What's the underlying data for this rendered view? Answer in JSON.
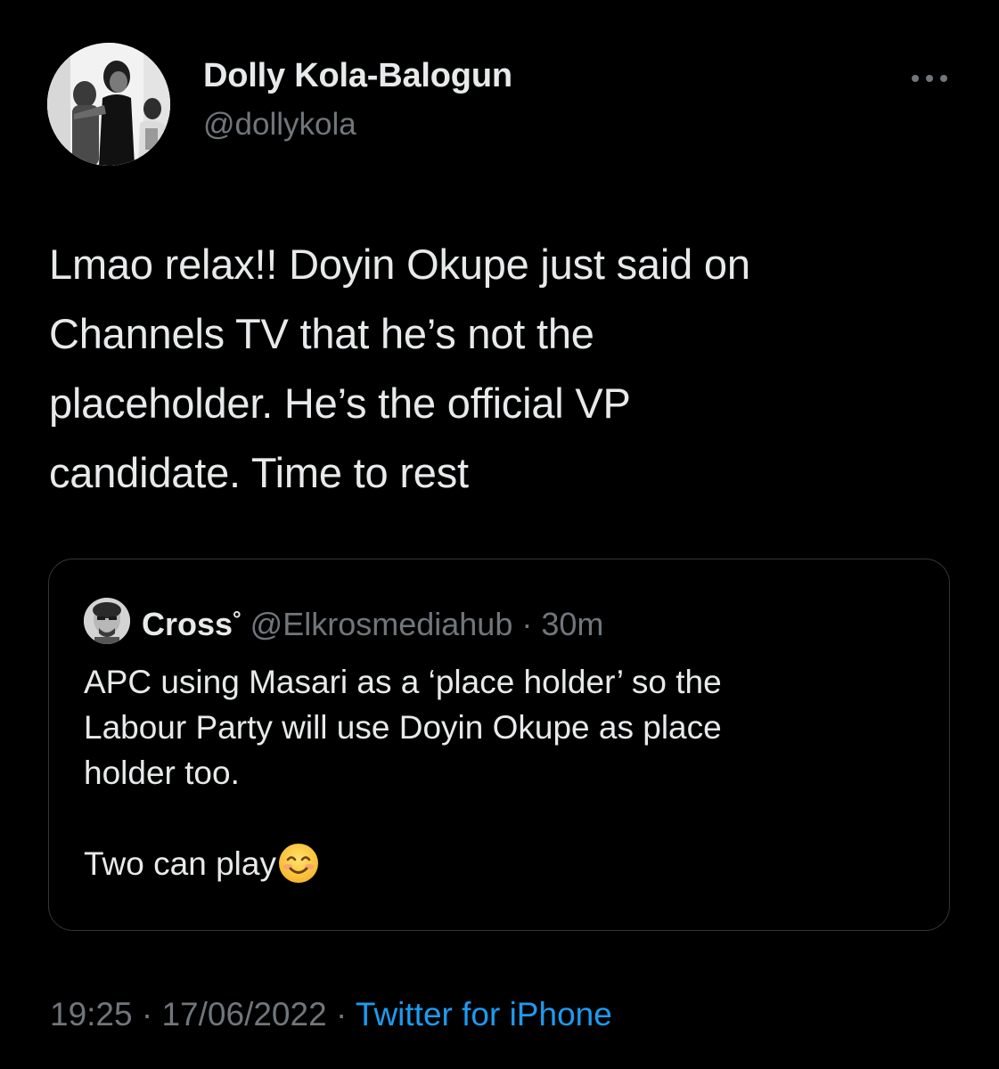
{
  "author": {
    "display_name": "Dolly Kola-Balogun",
    "handle": "@dollykola",
    "avatar_icon": "profile-photo"
  },
  "more_icon": "more-horizontal-icon",
  "tweet": {
    "lines": [
      "Lmao relax!! Doyin Okupe just said on",
      "Channels TV that he’s not the",
      "placeholder. He’s the official VP",
      "candidate. Time to rest"
    ]
  },
  "quote": {
    "avatar_icon": "quoted-user-avatar",
    "display_name": "Cross",
    "name_suffix": "°",
    "handle": "@Elkrosmediahub",
    "separator": " · ",
    "time": "30m",
    "lines": [
      "APC using Masari as a ‘place holder’ so the",
      "Labour Party will use Doyin Okupe as place",
      "holder too.",
      "",
      "Two can play"
    ],
    "emoji_icon": "smiling-face-emoji"
  },
  "footer": {
    "time": "19:25",
    "separator": " · ",
    "date": "17/06/2022",
    "source": "Twitter for iPhone"
  },
  "colors": {
    "background": "#000000",
    "primary_text": "#e7e9ea",
    "secondary_text": "#71767b",
    "link": "#1d9bf0",
    "border": "#333639"
  }
}
